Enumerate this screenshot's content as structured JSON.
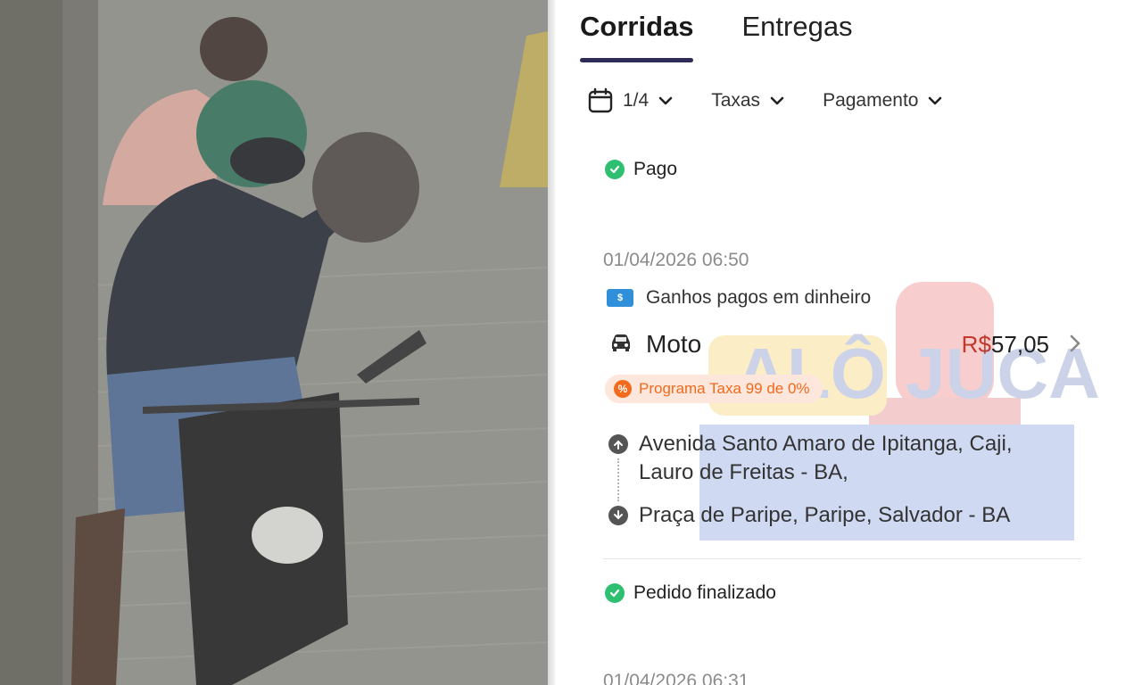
{
  "tabs": [
    {
      "label": "Corridas",
      "active": true
    },
    {
      "label": "Entregas",
      "active": false
    }
  ],
  "filters": {
    "date": "1/4",
    "fees": "Taxas",
    "payment": "Pagamento"
  },
  "status_paid": "Pago",
  "ride": {
    "datetime": "01/04/2026 06:50",
    "earnings_note": "Ganhos pagos em dinheiro",
    "type": "Moto",
    "currency": "R$",
    "amount": "57,05",
    "promo": "Programa Taxa 99 de 0%",
    "origin_line1": "Avenida Santo Amaro de Ipitanga, Caji,",
    "origin_line2": "Lauro de Freitas - BA,",
    "destination": "Praça de Paripe, Paripe, Salvador - BA"
  },
  "status_finished": "Pedido finalizado",
  "next_ride_datetime": "01/04/2026 06:31",
  "watermark": "ALÔ JUCA",
  "colors": {
    "accent_underline": "#2e2b58",
    "paid_green": "#2fbf71",
    "promo_orange": "#f26a1b",
    "promo_bg": "#fde7dc",
    "currency_red": "#c0392b"
  },
  "icons": [
    "calendar-icon",
    "chevron-down-icon",
    "check-circle-icon",
    "cash-icon",
    "car-icon",
    "chevron-right-icon",
    "percent-badge-icon",
    "pickup-pin-icon",
    "dropoff-pin-icon"
  ]
}
